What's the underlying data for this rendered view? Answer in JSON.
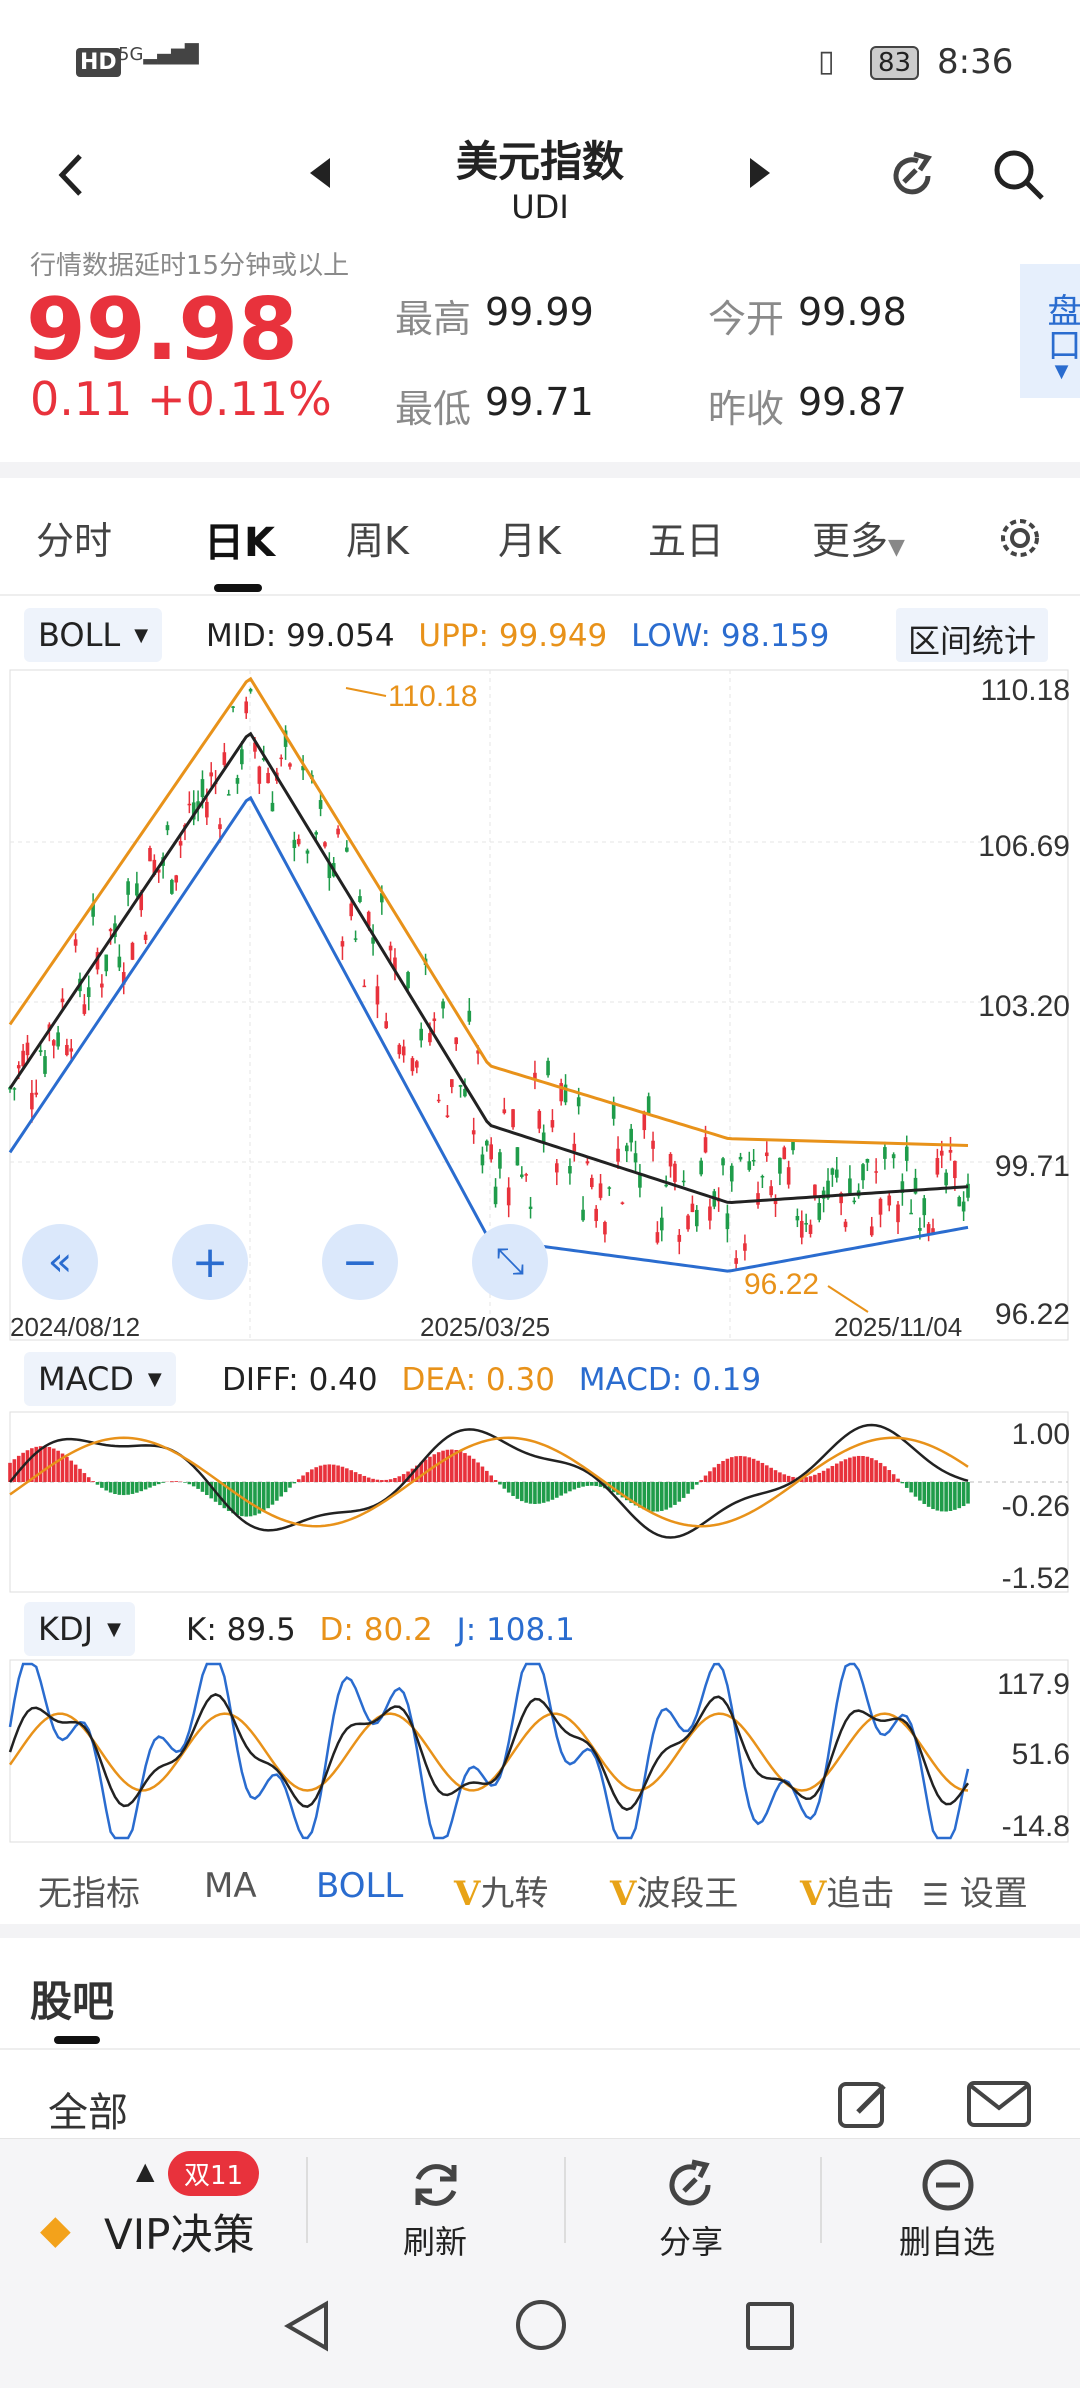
{
  "status_bar": {
    "network": "HD",
    "signal": "5G",
    "battery": "83",
    "time": "8:36"
  },
  "header": {
    "title": "美元指数",
    "subtitle": "UDI"
  },
  "quote": {
    "delay_note": "行情数据延时15分钟或以上",
    "price": "99.98",
    "change": "0.11 +0.11%",
    "high_label": "最高",
    "high": "99.99",
    "open_label": "今开",
    "open": "99.98",
    "low_label": "最低",
    "low": "99.71",
    "prev_label": "昨收",
    "prev": "99.87",
    "side_btn": "盘口"
  },
  "tabs": [
    {
      "label": "分时"
    },
    {
      "label": "日K"
    },
    {
      "label": "周K"
    },
    {
      "label": "月K"
    },
    {
      "label": "五日"
    },
    {
      "label": "更多"
    }
  ],
  "boll": {
    "selector": "BOLL",
    "mid_label": "MID:",
    "mid": "99.054",
    "upp_label": "UPP:",
    "upp": "99.949",
    "low_label": "LOW:",
    "low": "98.159",
    "stats_btn": "区间统计",
    "y_ticks": [
      "110.18",
      "106.69",
      "103.20",
      "99.71",
      "96.22"
    ],
    "x_ticks": [
      "2024/08/12",
      "2025/03/25",
      "2025/11/04"
    ],
    "max_label": "110.18",
    "min_label": "96.22"
  },
  "macd": {
    "selector": "MACD",
    "diff_label": "DIFF:",
    "diff": "0.40",
    "dea_label": "DEA:",
    "dea": "0.30",
    "macd_label": "MACD:",
    "macd": "0.19",
    "y_ticks": [
      "1.00",
      "-0.26",
      "-1.52"
    ]
  },
  "kdj": {
    "selector": "KDJ",
    "k_label": "K:",
    "k": "89.5",
    "d_label": "D:",
    "d": "80.2",
    "j_label": "J:",
    "j": "108.1",
    "y_ticks": [
      "117.9",
      "51.6",
      "-14.8"
    ]
  },
  "indicators": [
    "无指标",
    "MA",
    "BOLL",
    "九转",
    "波段王",
    "追击",
    "设置"
  ],
  "guba": {
    "title": "股吧",
    "filter": "全部"
  },
  "bottom_nav": {
    "vip_badge": "双11",
    "vip": "VIP决策",
    "refresh": "刷新",
    "share": "分享",
    "remove": "删自选"
  },
  "colors": {
    "up": "#e8323c",
    "down": "#1f9c4a",
    "upp": "#e8921a",
    "low": "#2a6ccf",
    "mid": "#222222"
  },
  "chart_data": {
    "type": "line",
    "title": "",
    "note": "Daily candlestick chart with Bollinger bands; approximate close values",
    "x": [
      "2024/08/12",
      "2025/03/25",
      "2025/11/04"
    ],
    "series": [
      {
        "name": "MID",
        "values": [
          101.2,
          109.0,
          100.4,
          98.7,
          99.05
        ]
      },
      {
        "name": "UPP",
        "values": [
          102.6,
          110.2,
          101.7,
          100.1,
          99.95
        ]
      },
      {
        "name": "LOW",
        "values": [
          99.8,
          107.6,
          97.9,
          97.2,
          98.16
        ]
      }
    ],
    "ylim": [
      96.22,
      110.18
    ],
    "max": 110.18,
    "min": 96.22
  }
}
